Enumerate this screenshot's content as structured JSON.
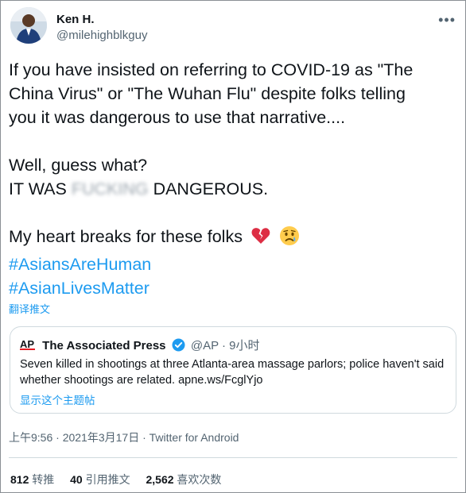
{
  "author": {
    "name": "Ken H.",
    "handle": "@milehighblkguy"
  },
  "more_icon": "more-dots-icon",
  "tweet": {
    "lines": [
      "If you have insisted on referring to COVID-19 as \"The",
      "China Virus\" or \"The Wuhan Flu\" despite folks telling",
      "you it was dangerous to use that narrative...."
    ],
    "line4": "Well, guess what?",
    "line5_pre": "IT WAS ",
    "line5_blur": "FUCKING",
    "line5_post": " DANGEROUS.",
    "line6": "My heart breaks for these folks",
    "emojis": [
      "broken-heart-icon",
      "crying-face-icon"
    ],
    "hashtags": [
      "#AsiansAreHuman",
      "#AsianLivesMatter"
    ],
    "translate_label": "翻译推文"
  },
  "quote": {
    "name": "The Associated Press",
    "handle_time": "@AP · 9小时",
    "text": "Seven killed in shootings at three Atlanta-area massage parlors; police haven't said whether shootings are related. apne.ws/FcglYjo",
    "show_thread": "显示这个主题帖"
  },
  "meta": "上午9:56 · 2021年3月17日 · Twitter for Android",
  "stats": {
    "retweets_count": "812",
    "retweets_label": " 转推",
    "quotes_count": "40",
    "quotes_label": " 引用推文",
    "likes_count": "2,562",
    "likes_label": " 喜欢次数"
  },
  "colors": {
    "accent": "#1d9bf0",
    "muted": "#536471",
    "text": "#0f1419",
    "border": "#cfd9de",
    "ap_red": "#e31b23"
  }
}
